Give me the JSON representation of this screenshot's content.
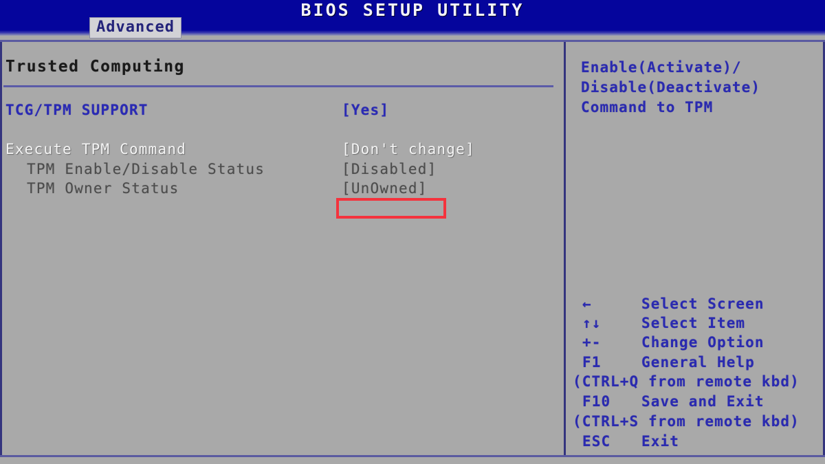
{
  "header": {
    "title": "BIOS SETUP UTILITY",
    "active_tab": "Advanced"
  },
  "colors": {
    "header_blue": "#05059c",
    "panel_gray": "#a9a9a9",
    "value_blue": "#2a2ab4",
    "selected_white": "#f4f4f4",
    "readonly_gray": "#4c4c4c",
    "annotation_red": "#f4333d",
    "rule_blue": "#5b5ba8"
  },
  "main": {
    "section_title": "Trusted Computing",
    "rows": [
      {
        "label": "TCG/TPM SUPPORT",
        "value": "[Yes]",
        "style": "blue"
      },
      {
        "label": "Execute TPM Command",
        "value": "[Don't change]",
        "style": "white"
      },
      {
        "label": "TPM Enable/Disable Status",
        "value": "[Disabled]",
        "style": "gray"
      },
      {
        "label": "TPM Owner Status",
        "value": "[UnOwned]",
        "style": "gray"
      }
    ],
    "annotation": {
      "target_value": "[Disabled]",
      "color": "#f4333d"
    }
  },
  "help": {
    "lines": [
      "Enable(Activate)/",
      "Disable(Deactivate)",
      "Command to TPM"
    ]
  },
  "legend": {
    "entries": [
      {
        "key": "←",
        "desc": "Select Screen"
      },
      {
        "key": "↑↓",
        "desc": "Select Item"
      },
      {
        "key": "+-",
        "desc": "Change Option"
      },
      {
        "key": "F1",
        "desc": "General Help"
      }
    ],
    "note_1": "(CTRL+Q from remote kbd)",
    "entry_f10": {
      "key": "F10",
      "desc": "Save and Exit"
    },
    "note_2": "(CTRL+S from remote kbd)",
    "entry_esc": {
      "key": "ESC",
      "desc": "Exit"
    }
  }
}
